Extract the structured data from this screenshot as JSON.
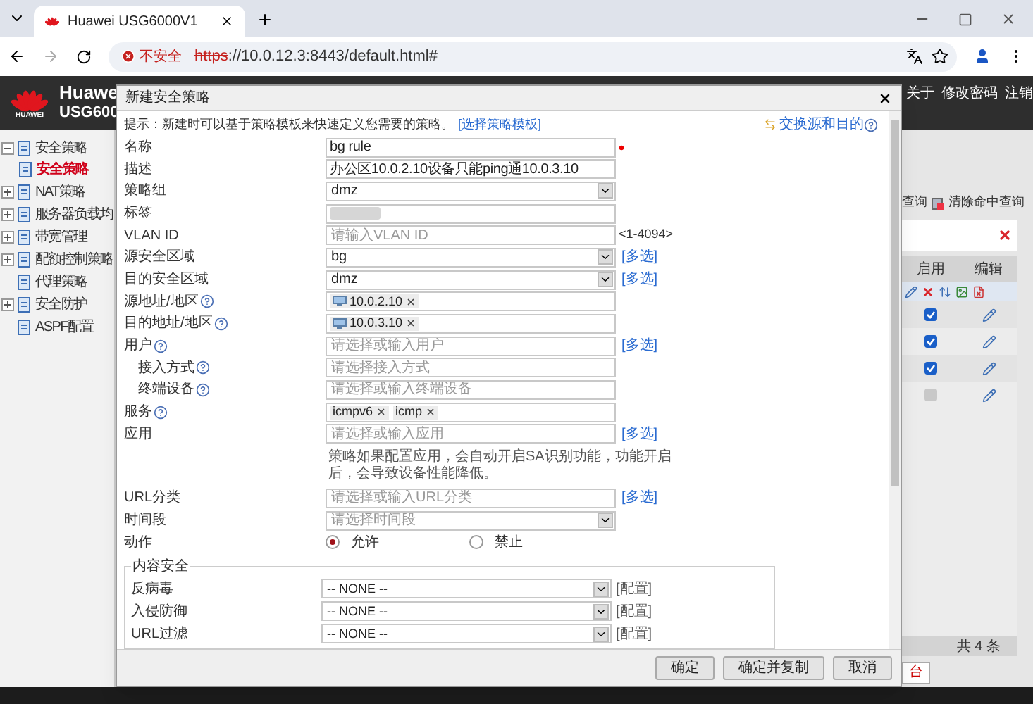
{
  "browser": {
    "tab_title": "Huawei USG6000V1",
    "security_label": "不安全",
    "url_scheme": "https",
    "url_rest": "://10.0.12.3:8443/default.html#"
  },
  "header": {
    "brand": "HUAWEI",
    "product_line1": "Huawe",
    "product_line2": "USG600",
    "links": [
      "关于",
      "修改密码",
      "注销"
    ]
  },
  "sidebar": {
    "items": [
      {
        "label": "安全策略",
        "kind": "folder",
        "expanded": true,
        "selected": false,
        "children": [
          {
            "label": "安全策略",
            "selected": true
          }
        ]
      },
      {
        "label": "NAT策略",
        "kind": "folder",
        "expanded": false,
        "selected": false
      },
      {
        "label": "服务器负载均",
        "kind": "folder",
        "expanded": false,
        "selected": false
      },
      {
        "label": "带宽管理",
        "kind": "folder",
        "expanded": false,
        "selected": false
      },
      {
        "label": "配额控制策略",
        "kind": "folder",
        "expanded": false,
        "selected": false
      },
      {
        "label": "代理策略",
        "kind": "leaf",
        "selected": false
      },
      {
        "label": "安全防护",
        "kind": "folder",
        "expanded": false,
        "selected": false
      },
      {
        "label": "ASPF配置",
        "kind": "leaf",
        "selected": false
      }
    ]
  },
  "main": {
    "query": "查询",
    "clear_query": "清除命中查询",
    "table": {
      "columns": [
        "启用",
        "编辑"
      ],
      "rows": [
        {
          "checked": true,
          "disabled": false
        },
        {
          "checked": true,
          "disabled": false
        },
        {
          "checked": true,
          "disabled": false
        },
        {
          "checked": false,
          "disabled": true
        }
      ]
    },
    "total": "共 4 条",
    "bottom_tab": "台"
  },
  "dialog": {
    "title": "新建安全策略",
    "hint": "提示：新建时可以基于策略模板来快速定义您需要的策略。",
    "template_link": "[选择策略模板]",
    "swap_link": "交换源和目的",
    "fields": [
      {
        "label": "名称",
        "kind": "text",
        "value": "bg rule",
        "required": true,
        "help": false
      },
      {
        "label": "描述",
        "kind": "text",
        "value": "办公区10.0.2.10设备只能ping通10.0.3.10",
        "required": false,
        "help": false
      },
      {
        "label": "策略组",
        "kind": "select",
        "value": "dmz",
        "required": false,
        "help": false
      },
      {
        "label": "标签",
        "kind": "masked",
        "required": false,
        "help": false
      },
      {
        "label": "VLAN ID",
        "kind": "input",
        "placeholder": "请输入VLAN ID",
        "suffix": "<1-4094>",
        "required": false,
        "help": false
      },
      {
        "label": "源安全区域",
        "kind": "select",
        "value": "bg",
        "link": "[多选]",
        "required": false,
        "help": false
      },
      {
        "label": "目的安全区域",
        "kind": "select",
        "value": "dmz",
        "link": "[多选]",
        "required": false,
        "help": false
      },
      {
        "label": "源地址/地区",
        "kind": "tags",
        "tags": [
          {
            "text": "10.0.2.10",
            "icon": true
          }
        ],
        "required": false,
        "help": true
      },
      {
        "label": "目的地址/地区",
        "kind": "tags",
        "tags": [
          {
            "text": "10.0.3.10",
            "icon": true
          }
        ],
        "required": false,
        "help": true
      },
      {
        "label": "用户",
        "kind": "input",
        "placeholder": "请选择或输入用户",
        "link": "[多选]",
        "required": false,
        "help": true,
        "children": [
          {
            "label": "接入方式",
            "kind": "input",
            "placeholder": "请选择接入方式",
            "required": false,
            "help": true
          },
          {
            "label": "终端设备",
            "kind": "input",
            "placeholder": "请选择或输入终端设备",
            "required": false,
            "help": true
          }
        ]
      },
      {
        "label": "服务",
        "kind": "tags",
        "tags": [
          {
            "text": "icmpv6",
            "icon": false
          },
          {
            "text": "icmp",
            "icon": false
          }
        ],
        "required": false,
        "help": true
      },
      {
        "label": "应用",
        "kind": "input",
        "placeholder": "请选择或输入应用",
        "link": "[多选]",
        "note": "策略如果配置应用，会自动开启SA识别功能，功能开启后，会导致设备性能降低。",
        "required": false,
        "help": false
      },
      {
        "label": "URL分类",
        "kind": "input",
        "placeholder": "请选择或输入URL分类",
        "link": "[多选]",
        "required": false,
        "help": false
      },
      {
        "label": "时间段",
        "kind": "select",
        "placeholder": "请选择时间段",
        "required": false,
        "help": false
      },
      {
        "label": "动作",
        "kind": "radio",
        "options": [
          {
            "label": "允许",
            "selected": true
          },
          {
            "label": "禁止",
            "selected": false
          }
        ],
        "required": false,
        "help": false
      }
    ],
    "content_security": {
      "title": "内容安全",
      "rows": [
        {
          "label": "反病毒",
          "value": "-- NONE --",
          "link": "[配置]"
        },
        {
          "label": "入侵防御",
          "value": "-- NONE --",
          "link": "[配置]"
        },
        {
          "label": "URL过滤",
          "value": "-- NONE --",
          "link": "[配置]"
        }
      ]
    },
    "buttons": [
      "确定",
      "确定并复制",
      "取消"
    ]
  }
}
